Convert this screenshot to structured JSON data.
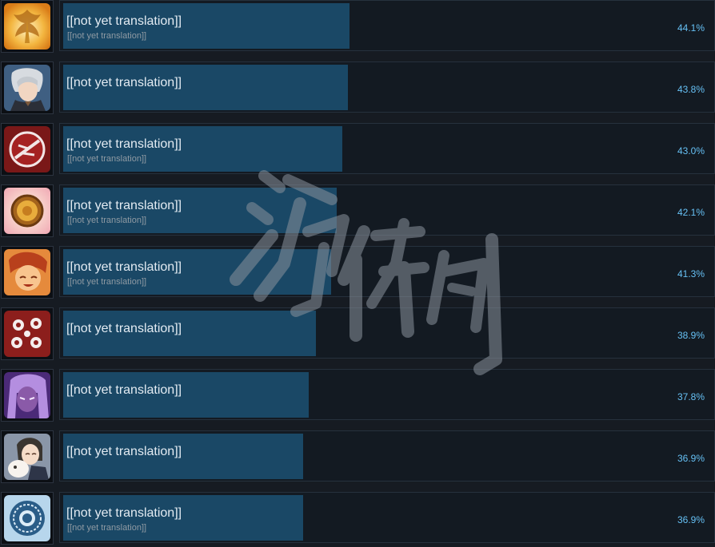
{
  "achievements": [
    {
      "name": "[[not yet translation]]",
      "description": "[[not yet translation]]",
      "percent_label": "44.1%",
      "bar_fraction": 0.441,
      "icon": "phoenix-gold-icon"
    },
    {
      "name": "[[not yet translation]]",
      "description": "",
      "percent_label": "43.8%",
      "bar_fraction": 0.438,
      "icon": "silver-hair-man-portrait-icon"
    },
    {
      "name": "[[not yet translation]]",
      "description": "[[not yet translation]]",
      "percent_label": "43.0%",
      "bar_fraction": 0.43,
      "icon": "red-emblem-icon"
    },
    {
      "name": "[[not yet translation]]",
      "description": "[[not yet translation]]",
      "percent_label": "42.1%",
      "bar_fraction": 0.421,
      "icon": "gold-medal-icon"
    },
    {
      "name": "[[not yet translation]]",
      "description": "[[not yet translation]]",
      "percent_label": "41.3%",
      "bar_fraction": 0.413,
      "icon": "red-hair-laughing-portrait-icon"
    },
    {
      "name": "[[not yet translation]]",
      "description": "",
      "percent_label": "38.9%",
      "bar_fraction": 0.389,
      "icon": "white-flowers-red-icon"
    },
    {
      "name": "[[not yet translation]]",
      "description": "",
      "percent_label": "37.8%",
      "bar_fraction": 0.378,
      "icon": "purple-hair-portrait-icon"
    },
    {
      "name": "[[not yet translation]]",
      "description": "",
      "percent_label": "36.9%",
      "bar_fraction": 0.369,
      "icon": "girl-with-lamb-portrait-icon"
    },
    {
      "name": "[[not yet translation]]",
      "description": "[[not yet translation]]",
      "percent_label": "36.9%",
      "bar_fraction": 0.369,
      "icon": "blue-mandala-icon"
    }
  ],
  "watermark_text": "游侠网",
  "colors": {
    "background": "#161b22",
    "bar_fill": "#1a4866",
    "percent_text": "#66c0f4",
    "title_text": "#e3ebf2",
    "description_text": "#8f9aa3"
  }
}
